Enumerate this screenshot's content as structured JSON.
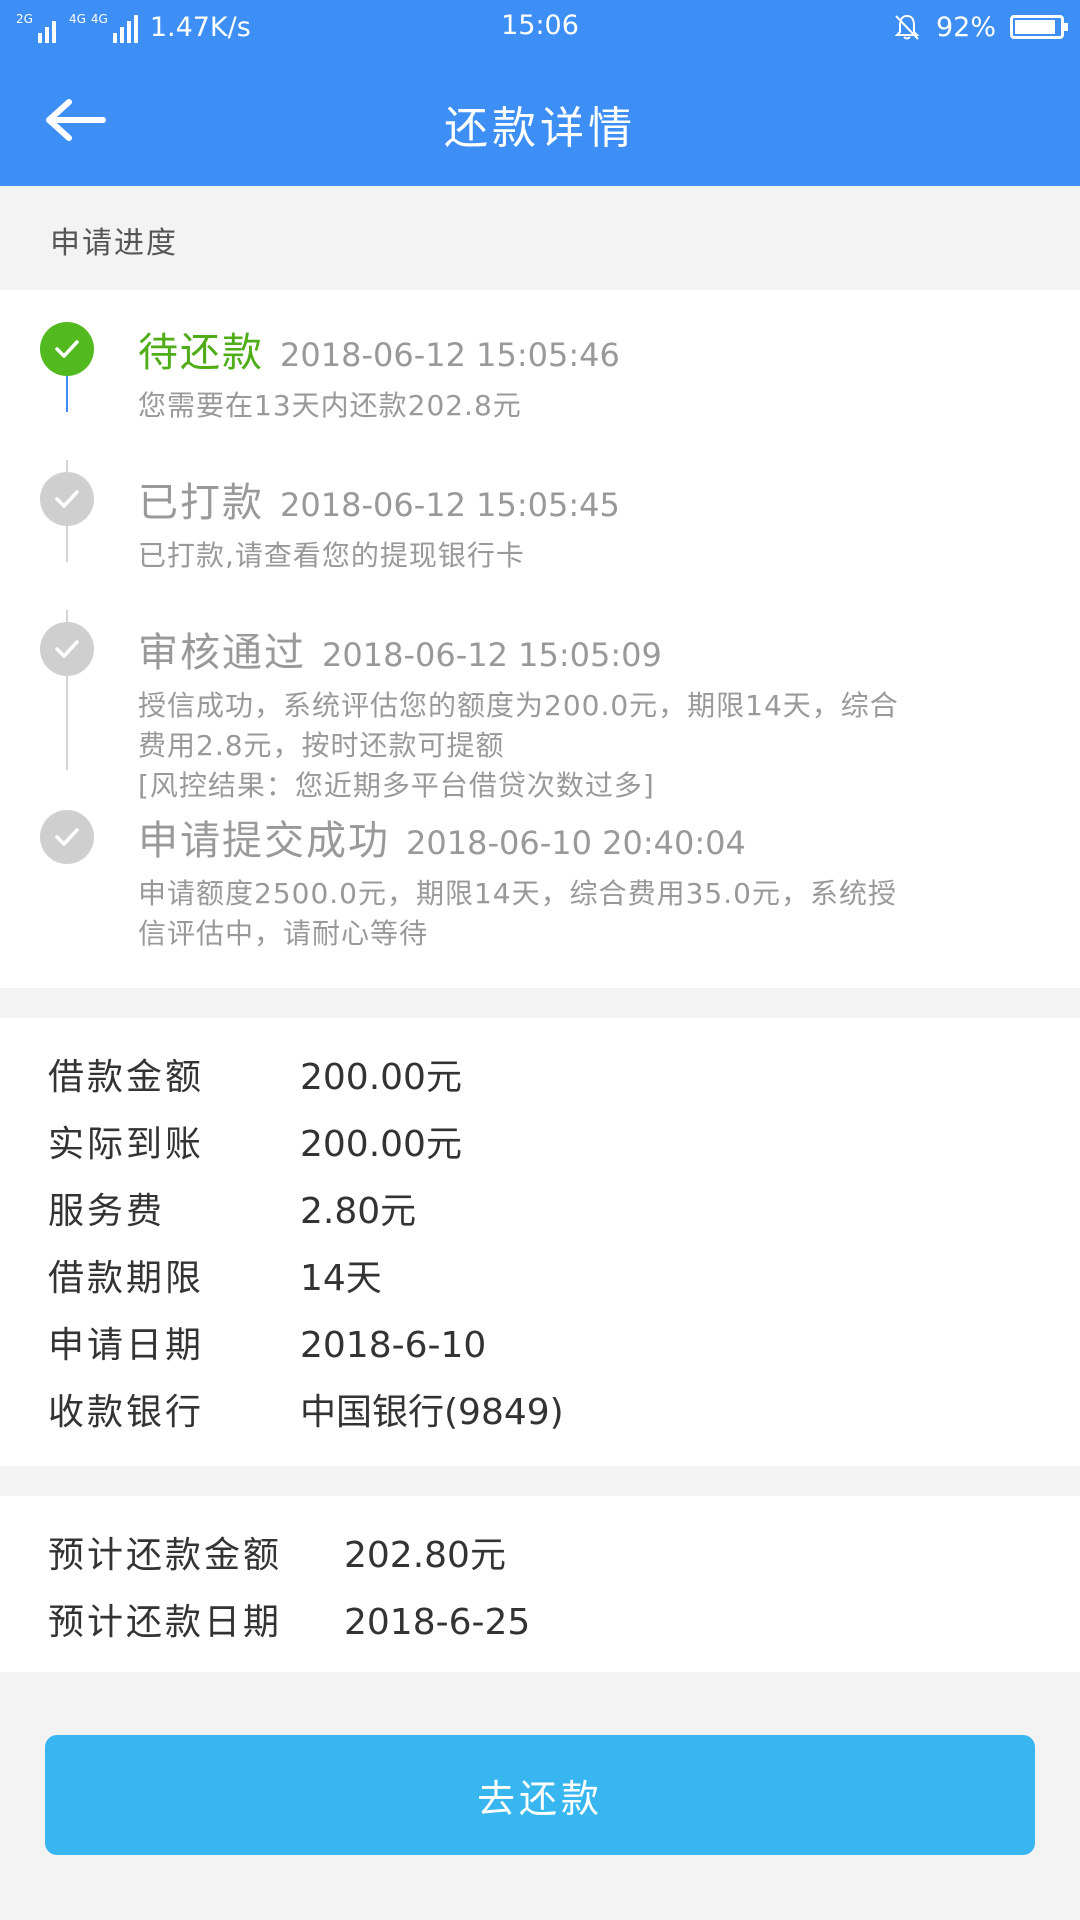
{
  "status_bar": {
    "signal_1": "2G",
    "signal_2": "4G",
    "signal_3": "4G",
    "net_speed": "1.47K/s",
    "time": "15:06",
    "battery": "92%",
    "battery_level": 0.92
  },
  "header": {
    "title": "还款详情",
    "back_icon": "arrow-left-icon"
  },
  "progress": {
    "section_title": "申请进度",
    "steps": [
      {
        "status": "待还款",
        "time": "2018-06-12 15:05:46",
        "desc": "您需要在13天内还款202.8元"
      },
      {
        "status": "已打款",
        "time": "2018-06-12 15:05:45",
        "desc": "已打款,请查看您的提现银行卡"
      },
      {
        "status": "审核通过",
        "time": "2018-06-12 15:05:09",
        "desc_line1": "授信成功，系统评估您的额度为200.0元，期限14天，综合",
        "desc_line2": "费用2.8元，按时还款可提额",
        "desc_line3": "[风控结果：您近期多平台借贷次数过多]"
      },
      {
        "status": "申请提交成功",
        "time": "2018-06-10 20:40:04",
        "desc_line1": "申请额度2500.0元，期限14天，综合费用35.0元，系统授",
        "desc_line2": "信评估中，请耐心等待"
      }
    ]
  },
  "loan_info": [
    {
      "label": "借款金额",
      "value": "200.00元"
    },
    {
      "label": "实际到账",
      "value": "200.00元"
    },
    {
      "label": "服务费",
      "value": "2.80元"
    },
    {
      "label": "借款期限",
      "value": "14天"
    },
    {
      "label": "申请日期",
      "value": "2018-6-10"
    },
    {
      "label": "收款银行",
      "value": "中国银行(9849)"
    }
  ],
  "repay_info": [
    {
      "label": "预计还款金额",
      "value": "202.80元"
    },
    {
      "label": "预计还款日期",
      "value": "2018-6-25"
    }
  ],
  "action": {
    "repay_button": "去还款"
  },
  "colors": {
    "primary": "#3d8ef5",
    "success": "#52b91e",
    "button": "#38b6f0"
  }
}
